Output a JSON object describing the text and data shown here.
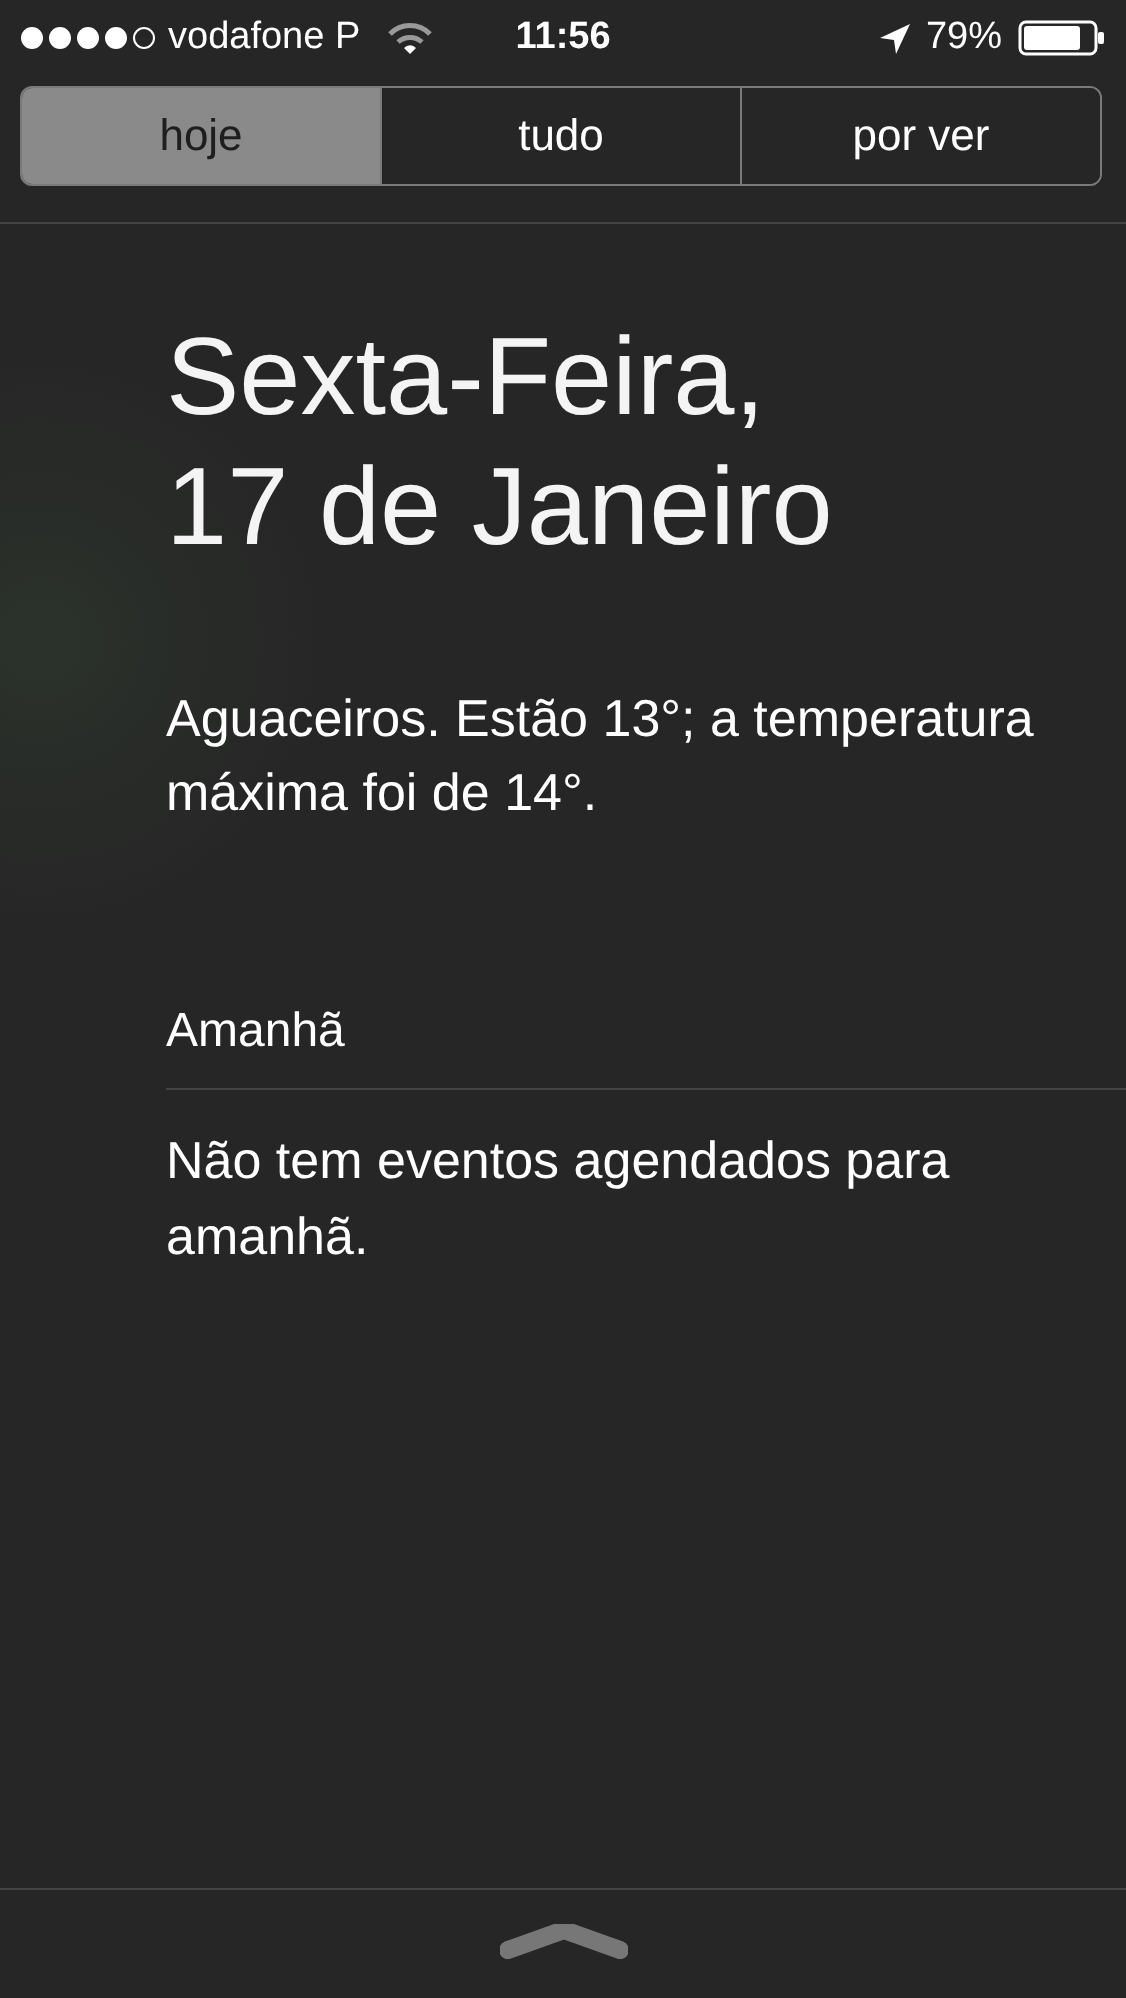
{
  "status_bar": {
    "carrier": "vodafone P",
    "time": "11:56",
    "battery": "79%"
  },
  "tabs": [
    {
      "label": "hoje",
      "selected": true
    },
    {
      "label": "tudo",
      "selected": false
    },
    {
      "label": "por ver",
      "selected": false
    }
  ],
  "today": {
    "date_lines": [
      "Sexta-Feira,",
      "17 de Janeiro"
    ],
    "weather": "Aguaceiros. Estão 13°; a temperatura máxima foi de 14°."
  },
  "tomorrow": {
    "heading": "Amanhã",
    "message": "Não tem eventos agendados para amanhã."
  }
}
